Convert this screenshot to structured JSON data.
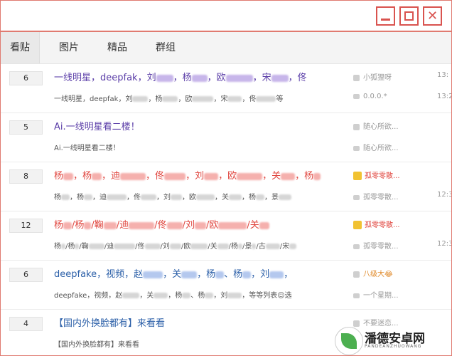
{
  "tabs": [
    "看贴",
    "图片",
    "精品",
    "群组"
  ],
  "window_controls": {
    "close_glyph": "✕"
  },
  "rows": [
    {
      "count": "6",
      "title_parts": [
        "一线明星，deepfak，刘",
        "，杨",
        "，欧",
        "，宋",
        "，佟"
      ],
      "summary_parts": [
        "一线明星，deepfak，刘",
        "，杨",
        "，欧",
        "，宋",
        "，佟",
        "等"
      ],
      "author": "小狐狸呀",
      "last_reply": "0.0.0.*",
      "time1": "13:",
      "time2": "13:2"
    },
    {
      "count": "5",
      "title_parts": [
        "Ai.一线明星看二楼！"
      ],
      "summary_parts": [
        "Ai.一线明星看二楼！"
      ],
      "author": "随心所欲...",
      "last_reply": "随心所欲...",
      "time1": "",
      "time2": ""
    },
    {
      "count": "8",
      "title_parts": [
        "杨",
        "，杨",
        "，迪",
        "，佟",
        "，刘",
        "，欧",
        "，关",
        "，杨"
      ],
      "summary_parts": [
        "杨",
        "，杨",
        "，迪",
        "，佟",
        "，刘",
        "，欧",
        "，关",
        "，杨",
        "，景"
      ],
      "author": "孤零零散...",
      "last_reply": "孤零零散...",
      "time1": "",
      "time2": "12:3"
    },
    {
      "count": "12",
      "title_parts": [
        "杨",
        "/杨",
        "/鞠",
        "/迪",
        "/佟",
        "/刘",
        "/欧",
        "/关"
      ],
      "summary_parts": [
        "杨",
        "/杨",
        "/鞠",
        "/迪",
        "/佟",
        "/刘",
        "/欧",
        "/关",
        "/杨",
        "/景",
        "/古",
        "/宋"
      ],
      "author": "孤零零散...",
      "last_reply": "孤零零散...",
      "time1": "",
      "time2": "12:3"
    },
    {
      "count": "6",
      "title_parts": [
        "deepfake，视频，赵",
        "，关",
        "，杨",
        "、杨",
        "，刘",
        "，"
      ],
      "summary_parts": [
        "deepfake，视频，赵",
        "，关",
        "，杨",
        "、杨",
        "，刘",
        "，等等列表☺选"
      ],
      "author": "八级大😂",
      "last_reply": "一个星期...",
      "time1": "",
      "time2": ""
    },
    {
      "count": "4",
      "title_parts": [
        "【国内外换脸都有】来看看"
      ],
      "summary_parts": [
        "【国内外换脸都有】来看看"
      ],
      "author": "不要迷恋...",
      "last_reply": "",
      "time1": "",
      "time2": ""
    }
  ],
  "watermark": {
    "name": "潘德安卓网",
    "sub": "PANDEANZHUOWANG"
  },
  "colors": {
    "accent_border": "#e07a70",
    "title_purple": "#5b3ea8",
    "title_red": "#e0463f",
    "title_blue": "#2b5fa8"
  }
}
